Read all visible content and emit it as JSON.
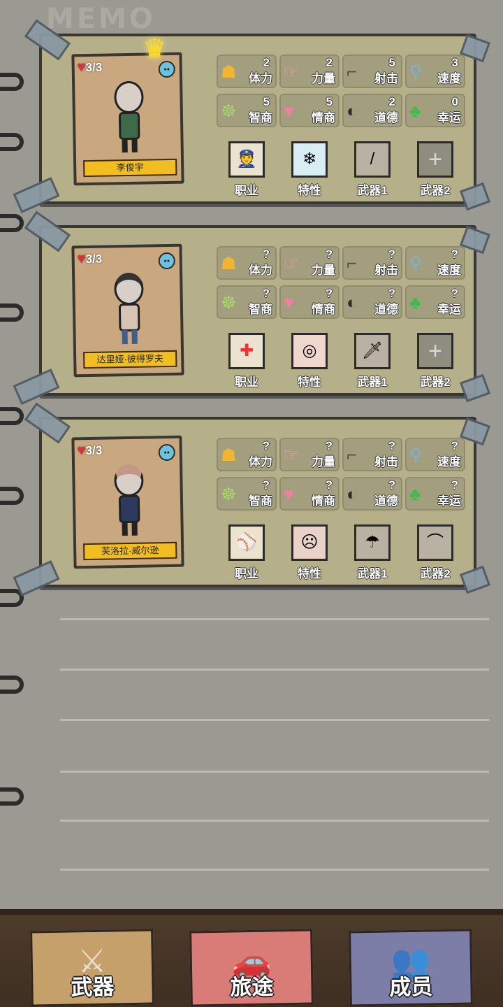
{
  "memo_title": "MEMO",
  "members": [
    {
      "hp": "3/3",
      "name": "李俊宇",
      "mood": "neutral",
      "stats": [
        {
          "label": "体力",
          "value": "2",
          "icon": "muscle-man-icon"
        },
        {
          "label": "力量",
          "value": "2",
          "icon": "flexed-arm-icon"
        },
        {
          "label": "射击",
          "value": "5",
          "icon": "pistol-icon"
        },
        {
          "label": "速度",
          "value": "3",
          "icon": "winged-boot-icon"
        },
        {
          "label": "智商",
          "value": "5",
          "icon": "brain-icon"
        },
        {
          "label": "情商",
          "value": "5",
          "icon": "heart-head-icon"
        },
        {
          "label": "道德",
          "value": "2",
          "icon": "half-mask-icon"
        },
        {
          "label": "幸运",
          "value": "0",
          "icon": "clover-icon"
        }
      ],
      "slots": [
        {
          "label": "职业",
          "icon": "police-officer-icon"
        },
        {
          "label": "特性",
          "icon": "frozen-person-icon"
        },
        {
          "label": "武器1",
          "icon": "baseball-bat-icon"
        },
        {
          "label": "武器2",
          "icon": "add-icon"
        }
      ]
    },
    {
      "hp": "3/3",
      "name": "达里娅·彼得罗夫",
      "mood": "sad",
      "stats": [
        {
          "label": "体力",
          "value": "?",
          "icon": "muscle-man-icon"
        },
        {
          "label": "力量",
          "value": "?",
          "icon": "flexed-arm-icon"
        },
        {
          "label": "射击",
          "value": "?",
          "icon": "pistol-icon"
        },
        {
          "label": "速度",
          "value": "?",
          "icon": "winged-boot-icon"
        },
        {
          "label": "智商",
          "value": "?",
          "icon": "brain-icon"
        },
        {
          "label": "情商",
          "value": "?",
          "icon": "heart-head-icon"
        },
        {
          "label": "道德",
          "value": "?",
          "icon": "half-mask-icon"
        },
        {
          "label": "幸运",
          "value": "?",
          "icon": "clover-icon"
        }
      ],
      "slots": [
        {
          "label": "职业",
          "icon": "doctor-icon"
        },
        {
          "label": "特性",
          "icon": "hypnotized-person-icon"
        },
        {
          "label": "武器1",
          "icon": "knife-icon"
        },
        {
          "label": "武器2",
          "icon": "add-icon"
        }
      ]
    },
    {
      "hp": "3/3",
      "name": "芙洛拉·威尔逊",
      "mood": "sad",
      "stats": [
        {
          "label": "体力",
          "value": "?",
          "icon": "muscle-man-icon"
        },
        {
          "label": "力量",
          "value": "?",
          "icon": "flexed-arm-icon"
        },
        {
          "label": "射击",
          "value": "?",
          "icon": "pistol-icon"
        },
        {
          "label": "速度",
          "value": "?",
          "icon": "winged-boot-icon"
        },
        {
          "label": "智商",
          "value": "?",
          "icon": "brain-icon"
        },
        {
          "label": "情商",
          "value": "?",
          "icon": "heart-head-icon"
        },
        {
          "label": "道德",
          "value": "?",
          "icon": "half-mask-icon"
        },
        {
          "label": "幸运",
          "value": "?",
          "icon": "clover-icon"
        }
      ],
      "slots": [
        {
          "label": "职业",
          "icon": "baseball-player-icon"
        },
        {
          "label": "特性",
          "icon": "angry-fat-person-icon"
        },
        {
          "label": "武器1",
          "icon": "umbrella-icon"
        },
        {
          "label": "武器2",
          "icon": "crowbar-icon"
        }
      ]
    }
  ],
  "nav": [
    {
      "label": "武器",
      "icon": "weapons-icon",
      "color": "#c6a06b"
    },
    {
      "label": "旅途",
      "icon": "car-icon",
      "color": "#d97b76"
    },
    {
      "label": "成员",
      "icon": "members-icon",
      "color": "#7d7ea8"
    }
  ]
}
